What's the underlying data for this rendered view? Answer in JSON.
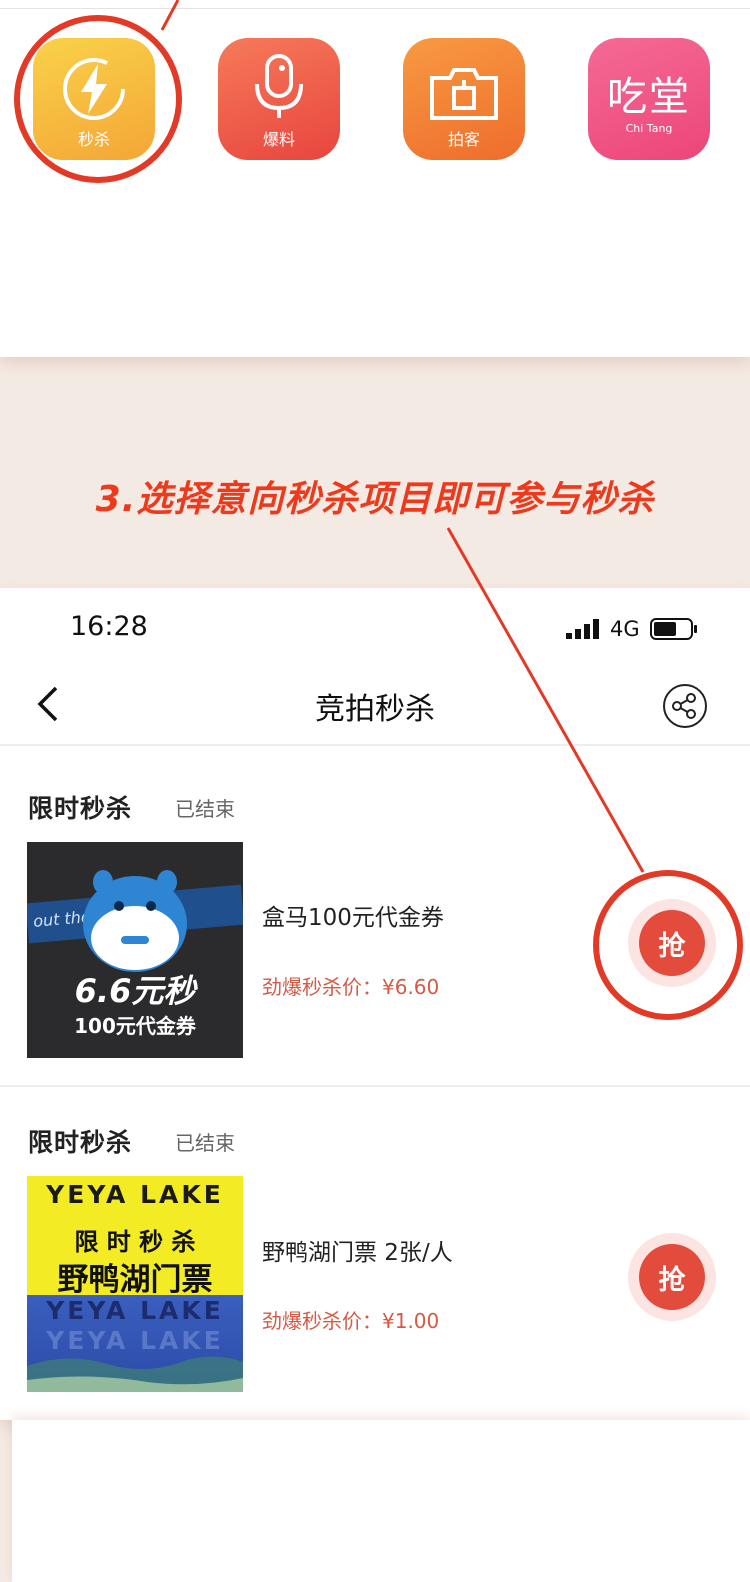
{
  "apps": [
    {
      "label": "秒杀",
      "icon": "lightning-icon"
    },
    {
      "label": "爆料",
      "icon": "microphone-icon"
    },
    {
      "label": "拍客",
      "icon": "camera-icon"
    },
    {
      "label": "",
      "icon": "chitang-logo-icon",
      "logo_text": "吃堂",
      "logo_sub": "Chi Tang"
    }
  ],
  "instruction": "3.选择意向秒杀项目即可参与秒杀",
  "status_bar": {
    "time": "16:28",
    "network": "4G"
  },
  "nav": {
    "title": "竞拍秒杀"
  },
  "items": [
    {
      "section_title": "限时秒杀",
      "status": "已结束",
      "name": "盒马100元代金券",
      "price": "劲爆秒杀价：¥6.60",
      "button": "抢",
      "thumb": {
        "banner": "out the    is why",
        "big": "6.6元秒",
        "small": "100元代金券"
      }
    },
    {
      "section_title": "限时秒杀",
      "status": "已结束",
      "name": "野鸭湖门票 2张/人",
      "price": "劲爆秒杀价：¥1.00",
      "button": "抢",
      "thumb": {
        "top": "YEYA LAKE",
        "line1": "限 时 秒 杀",
        "line2": "野鸭湖门票",
        "bottom1": "YEYA LAKE",
        "bottom2": "YEYA LAKE"
      }
    }
  ],
  "colors": {
    "accent": "#ee3a1c",
    "price": "#d45a45",
    "button": "#e34c3c"
  }
}
